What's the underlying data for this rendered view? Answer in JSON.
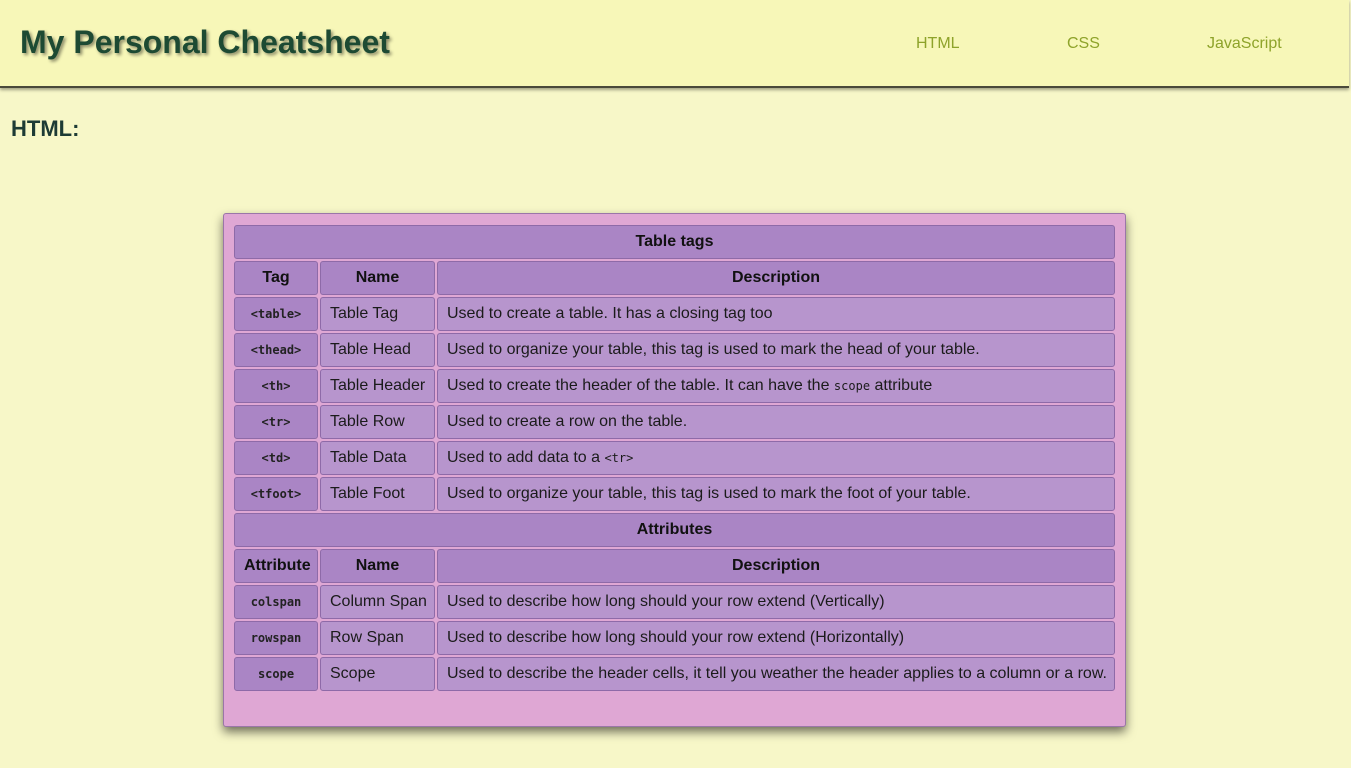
{
  "header": {
    "title": "My Personal Cheatsheet",
    "nav": [
      "HTML",
      "CSS",
      "JavaScript"
    ]
  },
  "section": {
    "title": "HTML:"
  },
  "table_tags": {
    "caption": "Table tags",
    "columns": [
      "Tag",
      "Name",
      "Description"
    ],
    "rows": [
      {
        "tag": "<table>",
        "name": "Table Tag",
        "desc": "Used to create a table. It has a closing tag too"
      },
      {
        "tag": "<thead>",
        "name": "Table Head",
        "desc": "Used to organize your table, this tag is used to mark the head of your table."
      },
      {
        "tag": "<th>",
        "name": "Table Header",
        "desc_pre": "Used to create the header of the table. It can have the ",
        "desc_code": "scope",
        "desc_post": " attribute"
      },
      {
        "tag": "<tr>",
        "name": "Table Row",
        "desc": "Used to create a row on the table."
      },
      {
        "tag": "<td>",
        "name": "Table Data",
        "desc_pre": "Used to add data to a ",
        "desc_code": "<tr>"
      },
      {
        "tag": "<tfoot>",
        "name": "Table Foot",
        "desc": "Used to organize your table, this tag is used to mark the foot of your table."
      }
    ]
  },
  "attributes": {
    "caption": "Attributes",
    "columns": [
      "Attribute",
      "Name",
      "Description"
    ],
    "rows": [
      {
        "tag": "colspan",
        "name": "Column Span",
        "desc": "Used to describe how long should your row extend (Vertically)"
      },
      {
        "tag": "rowspan",
        "name": "Row Span",
        "desc": "Used to describe how long should your row extend (Horizontally)"
      },
      {
        "tag": "scope",
        "name": "Scope",
        "desc": "Used to describe the header cells, it tell you weather the header applies to a column or a row."
      }
    ]
  },
  "colors": {
    "page_bg": "#f7f7c8",
    "header_bg": "#f7f7b8",
    "title_color": "#1d4a33",
    "nav_color": "#8ea32a",
    "table_bg": "#dfa7d4",
    "cell_header_bg": "#aa85c5",
    "cell_bg": "#b795cd"
  }
}
